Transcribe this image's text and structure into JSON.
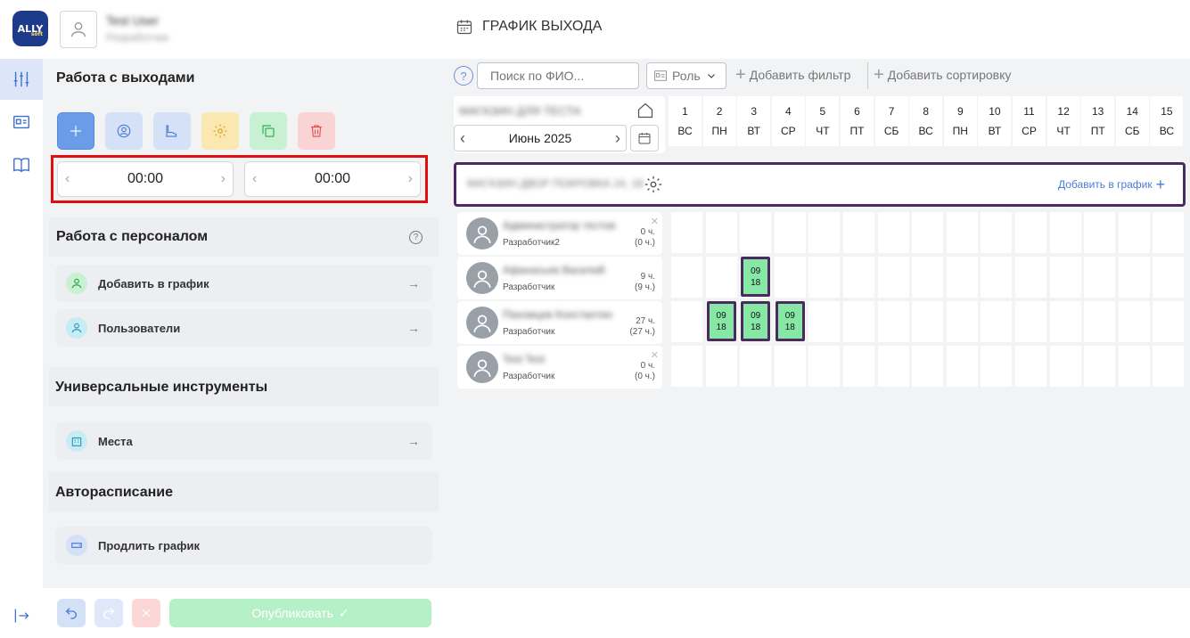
{
  "header": {
    "logo_text": "ALLY",
    "logo_sub": "soft",
    "user_name": "Test User",
    "user_role": "Разработчик",
    "title": "ГРАФИК ВЫХОДА"
  },
  "panel": {
    "exits_title": "Работа с выходами",
    "start_time": "00:00",
    "end_time": "00:00",
    "personnel_title": "Работа с персоналом",
    "personnel_items": [
      {
        "label": "Добавить в график"
      },
      {
        "label": "Пользователи"
      }
    ],
    "universal_title": "Универсальные инструменты",
    "universal_items": [
      {
        "label": "Места"
      }
    ],
    "auto_title": "Авторасписание",
    "auto_items": [
      {
        "label": "Продлить график"
      }
    ],
    "publish_label": "Опубликовать"
  },
  "filters": {
    "help": "?",
    "search_placeholder": "Поиск по ФИО...",
    "role_label": "Роль",
    "add_filter": "Добавить фильтр",
    "add_sort": "Добавить сортировку"
  },
  "calendar": {
    "org_name": "МАГАЗИН ДЛЯ ТЕСТА",
    "month": "Июнь 2025",
    "days": [
      {
        "num": "1",
        "dow": "ВС"
      },
      {
        "num": "2",
        "dow": "ПН"
      },
      {
        "num": "3",
        "dow": "ВТ"
      },
      {
        "num": "4",
        "dow": "СР"
      },
      {
        "num": "5",
        "dow": "ЧТ"
      },
      {
        "num": "6",
        "dow": "ПТ"
      },
      {
        "num": "7",
        "dow": "СБ"
      },
      {
        "num": "8",
        "dow": "ВС"
      },
      {
        "num": "9",
        "dow": "ПН"
      },
      {
        "num": "10",
        "dow": "ВТ"
      },
      {
        "num": "11",
        "dow": "СР"
      },
      {
        "num": "12",
        "dow": "ЧТ"
      },
      {
        "num": "13",
        "dow": "ПТ"
      },
      {
        "num": "14",
        "dow": "СБ"
      },
      {
        "num": "15",
        "dow": "ВС"
      }
    ]
  },
  "group": {
    "name": "МАГАЗИН ДВОР ПОКРОВКА 24, 18",
    "add_label": "Добавить в график"
  },
  "employees": [
    {
      "name": "Администратор тестов",
      "role": "Разработчик2",
      "hours": "0 ч.",
      "hours_sub": "(0 ч.)",
      "closable": true,
      "shifts": []
    },
    {
      "name": "Афанасьев Василий",
      "role": "Разработчик",
      "hours": "9 ч.",
      "hours_sub": "(9 ч.)",
      "closable": false,
      "shifts": [
        {
          "day": 3,
          "start": "09",
          "end": "18"
        }
      ]
    },
    {
      "name": "Пахомцев Константин",
      "role": "Разработчик",
      "hours": "27 ч.",
      "hours_sub": "(27 ч.)",
      "closable": false,
      "shifts": [
        {
          "day": 2,
          "start": "09",
          "end": "18"
        },
        {
          "day": 3,
          "start": "09",
          "end": "18"
        },
        {
          "day": 4,
          "start": "09",
          "end": "18"
        }
      ]
    },
    {
      "name": "Test Test",
      "role": "Разработчик",
      "hours": "0 ч.",
      "hours_sub": "(0 ч.)",
      "closable": true,
      "shifts": []
    }
  ],
  "colors": {
    "accent": "#4a7bd6",
    "shift_fill": "#86e8a4",
    "shift_border": "#4a2a5f",
    "highlight": "#e01010"
  }
}
